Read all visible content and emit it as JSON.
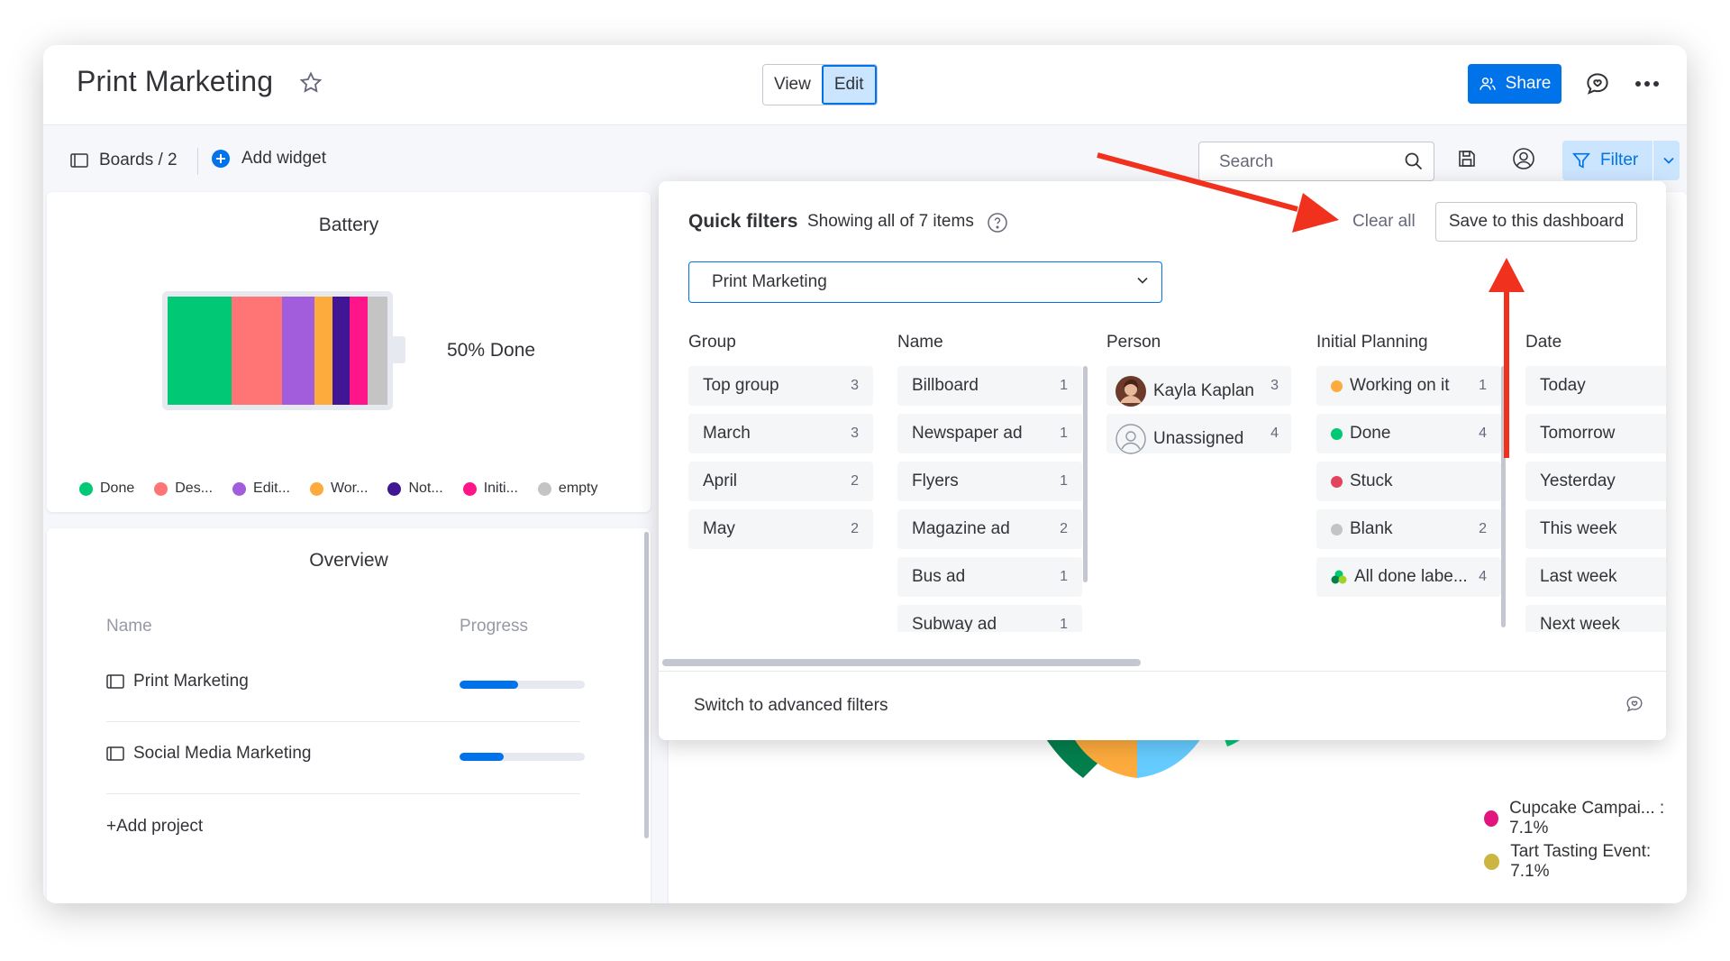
{
  "header": {
    "title": "Print Marketing",
    "view_label": "View",
    "edit_label": "Edit",
    "share_label": "Share"
  },
  "toolbar": {
    "boards_label": "Boards / 2",
    "add_widget_label": "Add widget",
    "search_placeholder": "Search",
    "filter_label": "Filter"
  },
  "battery": {
    "title": "Battery",
    "percent_label": "50% Done",
    "segments": [
      {
        "color": "#00c875",
        "share": 0.29
      },
      {
        "color": "#ff7575",
        "share": 0.23
      },
      {
        "color": "#a25ddc",
        "share": 0.15
      },
      {
        "color": "#fdab3d",
        "share": 0.08
      },
      {
        "color": "#401694",
        "share": 0.08
      },
      {
        "color": "#ff158a",
        "share": 0.08
      },
      {
        "color": "#c4c4c4",
        "share": 0.09
      }
    ],
    "legend": [
      {
        "label": "Done",
        "color": "#00c875"
      },
      {
        "label": "Des...",
        "color": "#ff7575"
      },
      {
        "label": "Edit...",
        "color": "#a25ddc"
      },
      {
        "label": "Wor...",
        "color": "#fdab3d"
      },
      {
        "label": "Not...",
        "color": "#401694"
      },
      {
        "label": "Initi...",
        "color": "#ff158a"
      },
      {
        "label": "empty",
        "color": "#c4c4c4"
      }
    ]
  },
  "overview": {
    "title": "Overview",
    "name_header": "Name",
    "progress_header": "Progress",
    "rows": [
      {
        "name": "Print Marketing",
        "progress": 0.47
      },
      {
        "name": "Social Media Marketing",
        "progress": 0.35
      }
    ],
    "add_project_label": "+Add project"
  },
  "pie_legend": [
    {
      "label": "Cupcake Campai... : 7.1%",
      "color": "#e2157e"
    },
    {
      "label": "Tart Tasting Event: 7.1%",
      "color": "#cab641"
    }
  ],
  "quick_filters": {
    "title": "Quick filters",
    "subtitle": "Showing all of 7 items",
    "clear_all_label": "Clear all",
    "save_label": "Save to this dashboard",
    "board_select_value": "Print Marketing",
    "advanced_label": "Switch to advanced filters",
    "columns": {
      "group": {
        "header": "Group",
        "items": [
          {
            "label": "Top group",
            "count": "3"
          },
          {
            "label": "March",
            "count": "3"
          },
          {
            "label": "April",
            "count": "2"
          },
          {
            "label": "May",
            "count": "2"
          }
        ]
      },
      "name": {
        "header": "Name",
        "items": [
          {
            "label": "Billboard",
            "count": "1"
          },
          {
            "label": "Newspaper ad",
            "count": "1"
          },
          {
            "label": "Flyers",
            "count": "1"
          },
          {
            "label": "Magazine ad",
            "count": "2"
          },
          {
            "label": "Bus ad",
            "count": "1"
          },
          {
            "label": "Subway ad",
            "count": "1"
          }
        ]
      },
      "person": {
        "header": "Person",
        "items": [
          {
            "label": "Kayla Kaplan",
            "count": "3"
          },
          {
            "label": "Unassigned",
            "count": "4"
          }
        ]
      },
      "planning": {
        "header": "Initial Planning",
        "items": [
          {
            "label": "Working on it",
            "count": "1",
            "color": "#fdab3d"
          },
          {
            "label": "Done",
            "count": "4",
            "color": "#00c875"
          },
          {
            "label": "Stuck",
            "count": "",
            "color": "#e2445c"
          },
          {
            "label": "Blank",
            "count": "2",
            "color": "#c4c4c4"
          },
          {
            "label": "All done labe...",
            "count": "4",
            "color": "#00c875"
          }
        ]
      },
      "date": {
        "header": "Date",
        "items": [
          {
            "label": "Today"
          },
          {
            "label": "Tomorrow"
          },
          {
            "label": "Yesterday"
          },
          {
            "label": "This week"
          },
          {
            "label": "Last week"
          },
          {
            "label": "Next week"
          }
        ]
      }
    }
  }
}
